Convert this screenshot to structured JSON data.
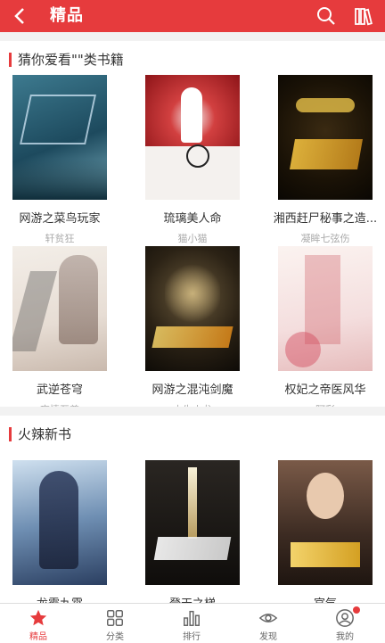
{
  "header": {
    "title": "精品"
  },
  "section1": {
    "title": "猜你爱看\"\"类书籍",
    "books": [
      {
        "name": "网游之菜鸟玩家",
        "author": "轩贫狂"
      },
      {
        "name": "琉璃美人命",
        "author": "猫小猫"
      },
      {
        "name": "湘西赶尸秘事之造...",
        "author": "凝眸七弦伤"
      },
      {
        "name": "武逆苍穹",
        "author": "忘情至尊"
      },
      {
        "name": "网游之混沌剑魔",
        "author": "小生火龙"
      },
      {
        "name": "权妃之帝医风华",
        "author": "阿彩"
      }
    ]
  },
  "section2": {
    "title": "火辣新书",
    "books": [
      {
        "name": "龙霸九霄"
      },
      {
        "name": "登天之梯"
      },
      {
        "name": "官气"
      }
    ]
  },
  "tabs": [
    {
      "label": "精品",
      "icon": "star-icon",
      "active": true
    },
    {
      "label": "分类",
      "icon": "grid-icon"
    },
    {
      "label": "排行",
      "icon": "bar-chart-icon"
    },
    {
      "label": "发现",
      "icon": "eye-icon"
    },
    {
      "label": "我的",
      "icon": "user-icon",
      "badge": true
    }
  ],
  "colors": {
    "accent": "#e63b3d"
  }
}
